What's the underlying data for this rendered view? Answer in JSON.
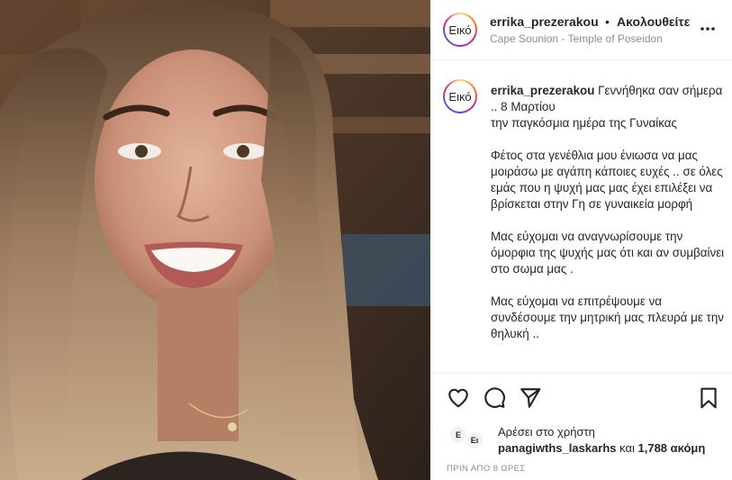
{
  "post": {
    "avatar_label": "Εικό",
    "username": "errika_prezerakou",
    "separator": "•",
    "follow_status": "Ακολουθείτε",
    "location": "Cape Sounion - Temple of Poseidon"
  },
  "caption": {
    "username": "errika_prezerakou",
    "paragraphs": [
      {
        "first": "Γεννήθηκα σαν σήμερα .. 8 Μαρτίου",
        "second": "την παγκόσμια ημέρα της Γυναίκας"
      },
      "Φέτος στα γενέθλια μου ένιωσα να μας μοιράσω με αγάπη κάποιες ευχές .. σε όλες εμάς που η ψυχή μας μας έχει επιλέξει να βρίσκεται στην Γη σε γυναικεία μορφή",
      "Μας εύχομαι να αναγνωρίσουμε την όμορφια της ψυχής μας ότι και αν συμβαίνει στο σωμα μας .",
      "Μας εύχομαι να επιτρέψουμε να συνδέσουμε την μητρική μας πλευρά με την θηλυκή .."
    ]
  },
  "actions": {
    "like_icon": "heart-icon",
    "comment_icon": "comment-icon",
    "share_icon": "send-icon",
    "save_icon": "bookmark-icon"
  },
  "likes": {
    "avatar_a": "Ε",
    "avatar_b": "Ει",
    "liked_by_text": "Αρέσει στο χρήστη",
    "liker_username": "panagiwths_laskarhs",
    "conjunction": "και",
    "others_count": "1,788 ακόμη"
  },
  "timestamp": "ΠΡΙΝ ΑΠΟ 8 ΩΡΕΣ",
  "colors": {
    "text": "#262626",
    "secondary": "#8e8e8e",
    "divider": "#efefef"
  }
}
